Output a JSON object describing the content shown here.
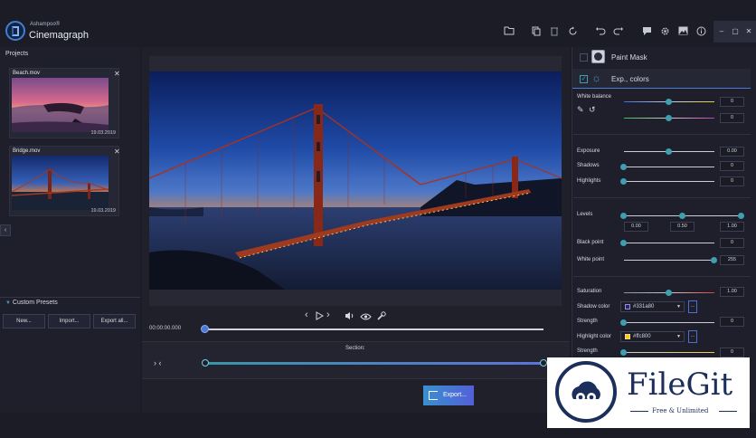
{
  "app": {
    "brand_small": "Ashampoo®",
    "brand_name": "Cinemagraph"
  },
  "toolbar_icons": [
    "folder-icon",
    "copy-icon",
    "trash-icon",
    "refresh-icon",
    "undo-icon",
    "redo-icon",
    "chat-icon",
    "gear-icon",
    "image-icon",
    "info-icon"
  ],
  "window_controls": [
    "minimize",
    "maximize",
    "close"
  ],
  "window_control_glyphs": {
    "minimize": "–",
    "maximize": "▢",
    "close": "✕"
  },
  "left": {
    "projects_label": "Projects",
    "projects": [
      {
        "name": "Beach.mov",
        "date": "19.03.2019"
      },
      {
        "name": "Bridge.mov",
        "date": "19.03.2019"
      }
    ],
    "presets_label": "Custom Presets",
    "preset_buttons": [
      "New...",
      "Import...",
      "Export all..."
    ]
  },
  "center": {
    "timecode": "00:00:00.000",
    "progress": 0.0,
    "section_label": "Section:",
    "export_label": "Export...",
    "controls": [
      "prev-icon",
      "play-icon",
      "next-icon",
      "volume-icon",
      "eye-icon",
      "wrench-icon"
    ]
  },
  "right": {
    "paint_mask_label": "Paint Mask",
    "exp_colors_label": "Exp., colors",
    "white_balance_label": "White balance",
    "wb_values": [
      "0",
      "0"
    ],
    "exposure_label": "Exposure",
    "exposure_value": "0.00",
    "shadows_label": "Shadows",
    "shadows_value": "0",
    "highlights_label": "Highlights",
    "highlights_value": "0",
    "levels_label": "Levels",
    "levels_values": [
      "0.00",
      "0.50",
      "1.00"
    ],
    "black_point_label": "Black point",
    "black_point_value": "0",
    "white_point_label": "White point",
    "white_point_value": "255",
    "saturation_label": "Saturation",
    "saturation_value": "1.00",
    "shadow_color_label": "Shadow color",
    "shadow_color_value": "#331a80",
    "strength_label": "Strength",
    "strength_value": "0",
    "highlight_color_label": "Highlight color",
    "highlight_color_value": "#ffc800",
    "strength2_label": "Strength",
    "strength2_value": "0",
    "dots_label": "..."
  },
  "watermark": {
    "title": "FileGit",
    "subtitle": "Free & Unlimited"
  },
  "colors": {
    "accent": "#4c78d8",
    "teal": "#3f9eb0",
    "background": "#1b1c26"
  }
}
